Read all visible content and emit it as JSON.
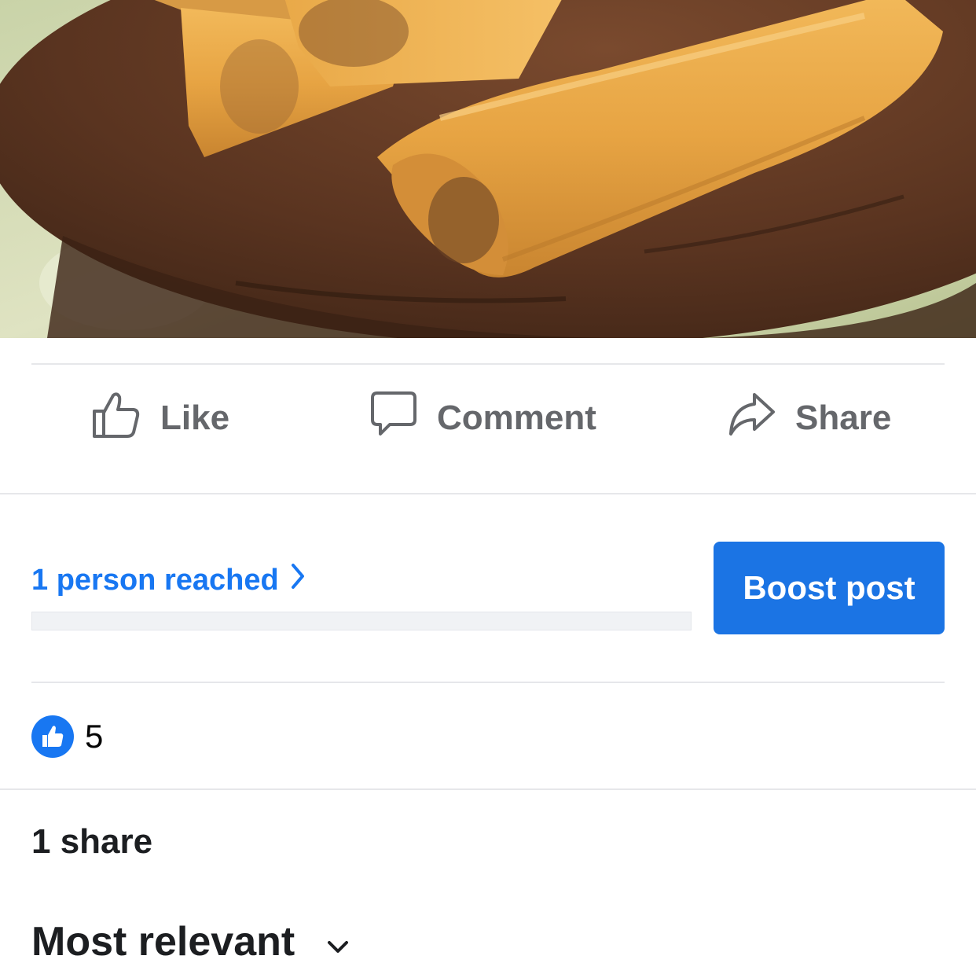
{
  "post_image": {
    "alt": ""
  },
  "actions": {
    "like_label": "Like",
    "comment_label": "Comment",
    "share_label": "Share"
  },
  "insights": {
    "reach_text": "1 person reached",
    "reach_progress": 0.0,
    "boost_label": "Boost post"
  },
  "reactions": {
    "count": "5"
  },
  "shares": {
    "text": "1 share"
  },
  "comments": {
    "sort_label": "Most relevant"
  },
  "colors": {
    "accent": "#1877f2",
    "button": "#1b74e4",
    "muted_text": "#65676b",
    "divider": "#e6e7ea"
  },
  "icons": [
    "thumbs-up-icon",
    "comment-bubble-icon",
    "share-arrow-icon",
    "chevron-right-icon",
    "like-reaction-icon",
    "chevron-down-icon"
  ]
}
